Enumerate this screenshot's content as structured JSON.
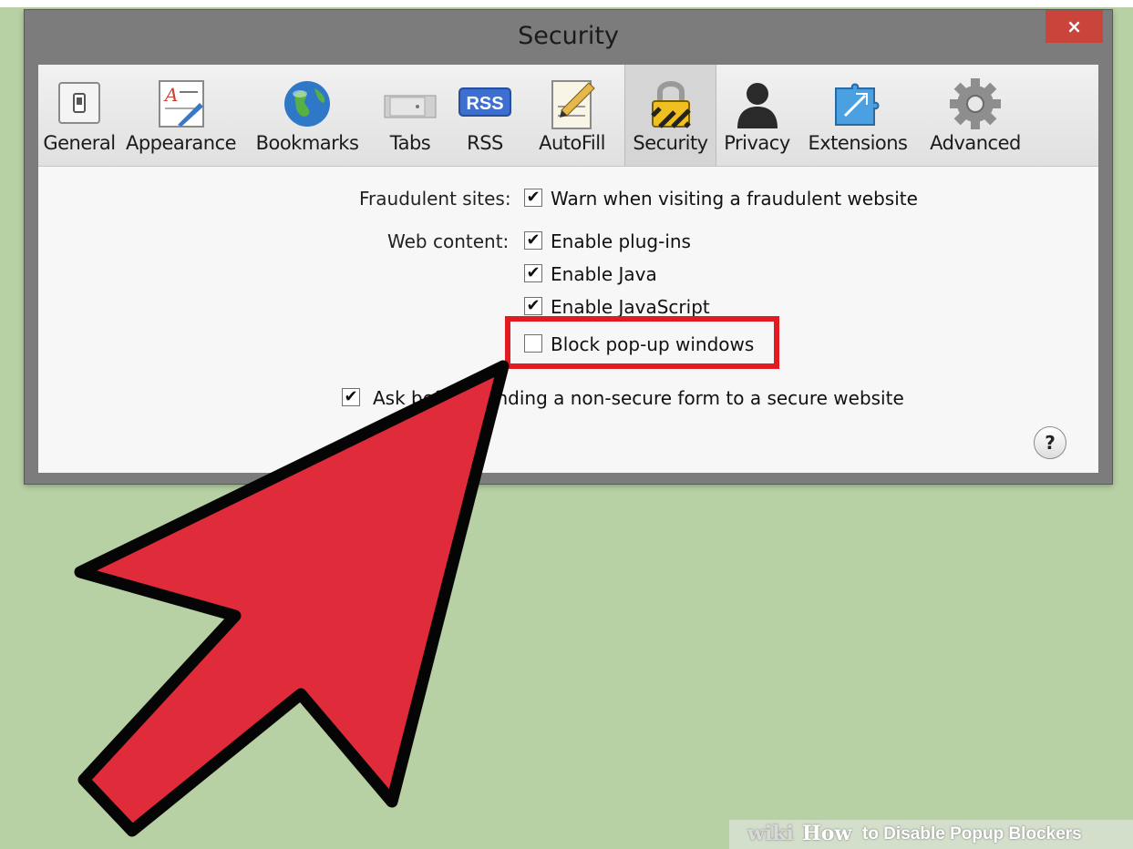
{
  "window": {
    "title": "Security",
    "close_label": "×"
  },
  "toolbar": {
    "tabs": [
      {
        "label": "General",
        "icon": "switch-icon"
      },
      {
        "label": "Appearance",
        "icon": "font-style-icon"
      },
      {
        "label": "Bookmarks",
        "icon": "globe-icon"
      },
      {
        "label": "Tabs",
        "icon": "tabs-icon"
      },
      {
        "label": "RSS",
        "icon": "rss-icon",
        "badge": "RSS"
      },
      {
        "label": "AutoFill",
        "icon": "pencil-form-icon"
      },
      {
        "label": "Security",
        "icon": "padlock-icon",
        "selected": true
      },
      {
        "label": "Privacy",
        "icon": "person-silhouette-icon"
      },
      {
        "label": "Extensions",
        "icon": "puzzle-piece-icon"
      },
      {
        "label": "Advanced",
        "icon": "gear-icon"
      }
    ]
  },
  "settings": {
    "fraudulent_label": "Fraudulent sites:",
    "fraudulent_option": {
      "text": "Warn when visiting a fraudulent website",
      "checked": true
    },
    "web_content_label": "Web content:",
    "web_content_options": [
      {
        "text": "Enable plug-ins",
        "checked": true
      },
      {
        "text": "Enable Java",
        "checked": true
      },
      {
        "text": "Enable JavaScript",
        "checked": true
      },
      {
        "text": "Block pop-up windows",
        "checked": false
      }
    ],
    "nonsecure_form_text": "Ask before sending a non-secure form to a secure website",
    "nonsecure_form_checked": true,
    "help_label": "?",
    "check_mark": "✔"
  },
  "watermark": {
    "wiki": "wiki",
    "how": "How",
    "rest": "to Disable Popup Blockers"
  },
  "colors": {
    "background": "#b7d1a4",
    "highlight_border": "#e21b22",
    "arrow_fill": "#e02b3a",
    "close_button": "#c9443a"
  }
}
